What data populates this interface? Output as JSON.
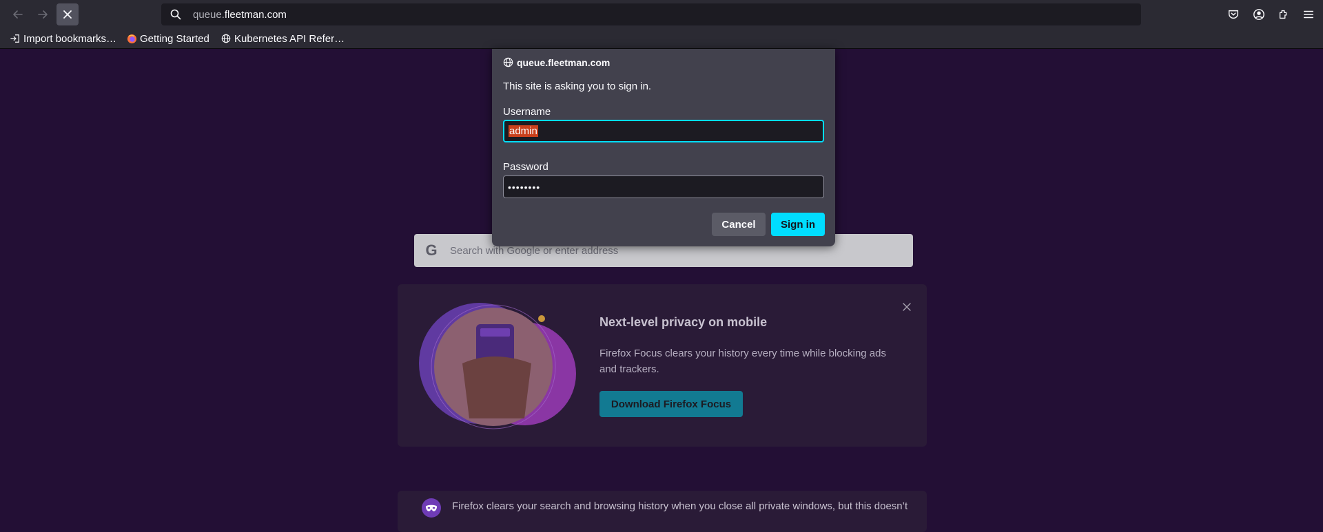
{
  "toolbar": {
    "url_prefix": "queue.",
    "url_domain": "fleetman.com",
    "back_icon": "arrow-left-icon",
    "forward_icon": "arrow-right-icon",
    "stop_icon": "close-icon",
    "search_icon": "search-icon",
    "right_icons": [
      "pocket-icon",
      "account-icon",
      "extensions-icon",
      "menu-icon"
    ]
  },
  "bookmarks": {
    "items": [
      {
        "label": "Import bookmarks…",
        "icon": "import-icon"
      },
      {
        "label": "Getting Started",
        "icon": "firefox-icon"
      },
      {
        "label": "Kubernetes API Refer…",
        "icon": "globe-icon"
      }
    ]
  },
  "dialog": {
    "origin": "queue.fleetman.com",
    "message": "This site is asking you to sign in.",
    "username_label": "Username",
    "username_value": "admin",
    "password_label": "Password",
    "password_value": "••••••••",
    "cancel_label": "Cancel",
    "signin_label": "Sign in"
  },
  "page": {
    "search_placeholder": "Search with Google or enter address",
    "promo": {
      "title": "Next-level privacy on mobile",
      "body": "Firefox Focus clears your history every time while blocking ads and trackers.",
      "button": "Download Firefox Focus"
    },
    "privacy_note": "Firefox clears your search and browsing history when you close all private windows, but this doesn’t"
  },
  "colors": {
    "page_bg": "#230f35",
    "chrome_bg": "#2b2a33",
    "dialog_bg": "#42414d",
    "accent": "#00ddff",
    "selection": "#c9401c",
    "promo_button": "#127a92"
  }
}
